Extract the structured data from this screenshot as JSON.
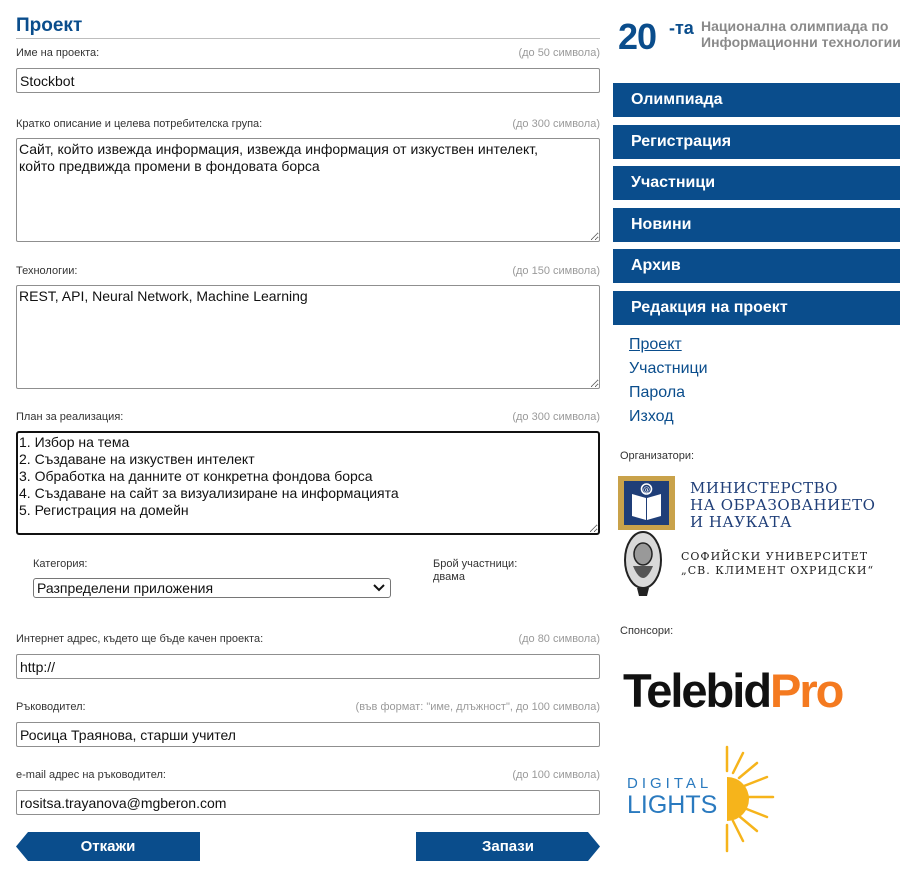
{
  "form": {
    "title": "Проект",
    "fields": [
      {
        "label": "Име на проекта:",
        "hint": "(до 50 символа)",
        "value": "Stockbot"
      },
      {
        "label": "Кратко описание и целева потребителска група:",
        "hint": "(до 300 символа)",
        "value": "Сайт, който извежда информация, извежда информация от изкуствен интелект,\nкойто предвижда промени в фондовата борса"
      },
      {
        "label": "Технологии:",
        "hint": "(до 150 символа)",
        "value": "REST, API, Neural Network, Machine Learning"
      },
      {
        "label": "План за реализация:",
        "hint": "(до 300 символа)",
        "value": "1. Избор на тема\n2. Създаване на изкуствен интелект\n3. Обработка на данните от конкретна фондова борса\n4. Създаване на сайт за визуализиране на информацията\n5. Регистрация на домейн"
      },
      {
        "label": "Интернет адрес, където ще бъде качен проекта:",
        "hint": "(до 80 символа)",
        "value": "http://"
      },
      {
        "label": "Ръководител:",
        "hint": "(във формат: \"име, длъжност\", до 100 символа)",
        "value": "Росица Траянова, старши учител"
      },
      {
        "label": "e-mail адрес на ръководител:",
        "hint": "(до 100 символа)",
        "value": "rositsa.trayanova@mgberon.com"
      }
    ],
    "category": {
      "label": "Категория:",
      "selected": "Разпределени приложения"
    },
    "participants": {
      "label": "Брой участници:",
      "value": "двама"
    },
    "cancel_label": "Откажи",
    "save_label": "Запази"
  },
  "sidebar": {
    "brand": {
      "number": "20",
      "suffix": "-та",
      "name": "Национална олимпиада по Информационни технологии"
    },
    "menu": [
      "Олимпиада",
      "Регистрация",
      "Участници",
      "Новини",
      "Архив",
      "Редакция на проект"
    ],
    "submenu": [
      "Проект",
      "Участници",
      "Парола",
      "Изход"
    ],
    "organizers_label": "Организатори:",
    "ministry_lines": [
      "МИНИСТЕРСТВО",
      "НА ОБРАЗОВАНИЕТО",
      "И НАУКАТА"
    ],
    "university_lines": [
      "СОФИЙСКИ УНИВЕРСИТЕТ",
      "„СВ. КЛИМЕНТ ОХРИДСКИ“"
    ],
    "sponsors_label": "Спонсори:",
    "telebid": [
      "Telebid",
      "Pro"
    ],
    "digital_lights": [
      "DIGITAL",
      "LIGHTS"
    ]
  },
  "colors": {
    "primary": "#0a4d8c",
    "accent_orange": "#f47a20",
    "sponsor_blue": "#2a7abf"
  }
}
